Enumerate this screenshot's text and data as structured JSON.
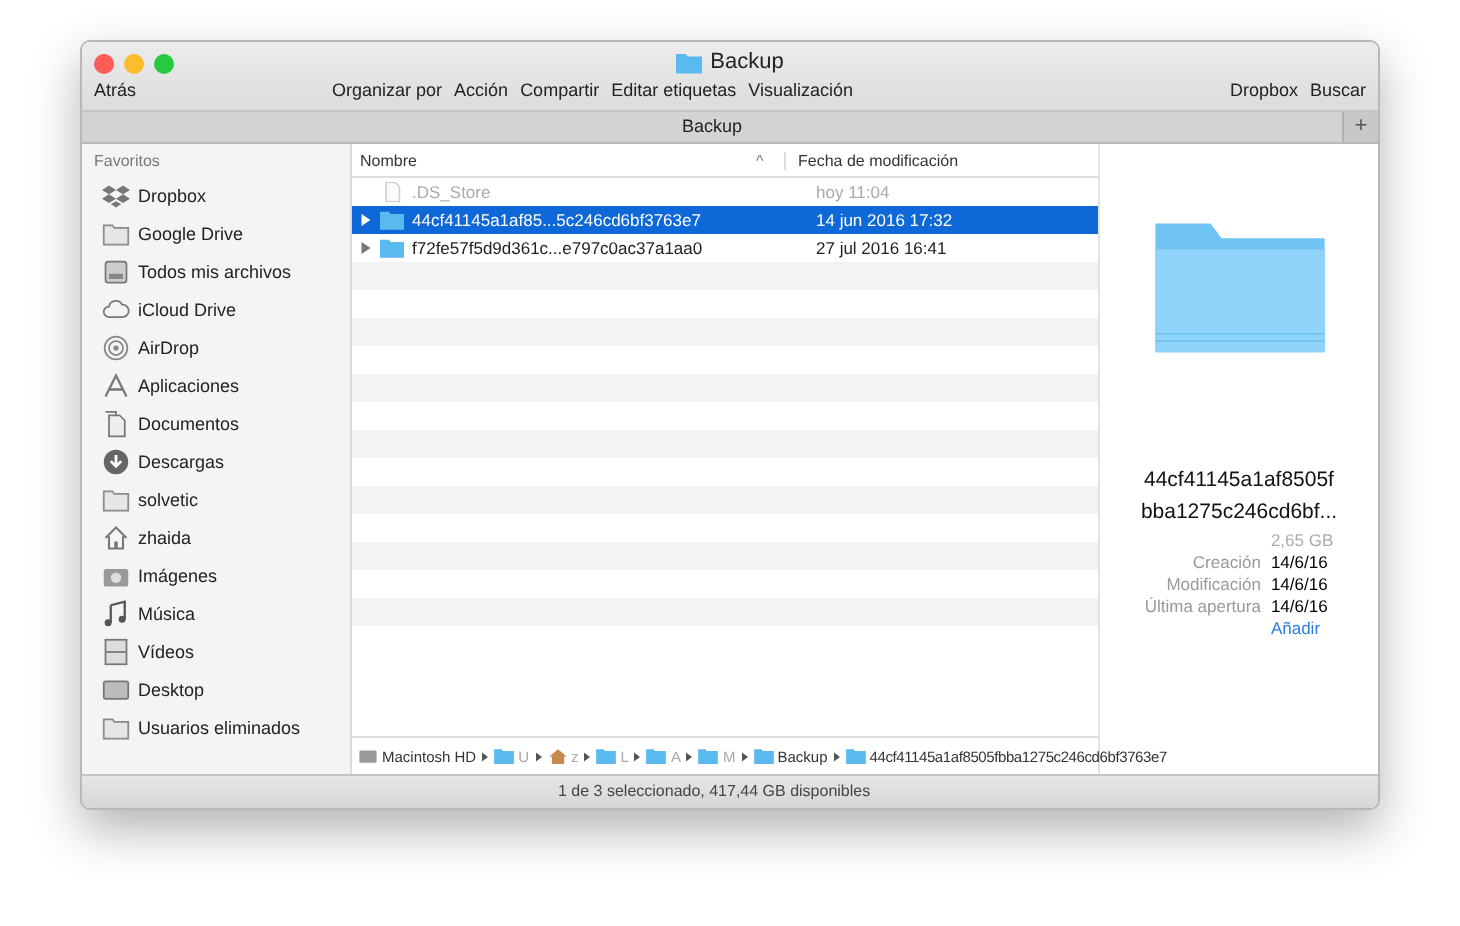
{
  "window": {
    "title": "Backup"
  },
  "toolbar": {
    "back": "Atrás",
    "actions": [
      "Organizar por",
      "Acción",
      "Compartir",
      "Editar etiquetas",
      "Visualización"
    ],
    "right": [
      "Dropbox",
      "Buscar"
    ]
  },
  "tab_bar": {
    "label": "Backup",
    "add": "+"
  },
  "sidebar": {
    "heading": "Favoritos",
    "items": [
      {
        "label": "Dropbox",
        "kind": "dropbox"
      },
      {
        "label": "Google Drive",
        "kind": "folder"
      },
      {
        "label": "Todos mis archivos",
        "kind": "drawer"
      },
      {
        "label": "iCloud Drive",
        "kind": "cloud"
      },
      {
        "label": "AirDrop",
        "kind": "airdrop"
      },
      {
        "label": "Aplicaciones",
        "kind": "apps"
      },
      {
        "label": "Documentos",
        "kind": "docs"
      },
      {
        "label": "Descargas",
        "kind": "download"
      },
      {
        "label": "solvetic",
        "kind": "folder"
      },
      {
        "label": "zhaida",
        "kind": "home"
      },
      {
        "label": "Imágenes",
        "kind": "camera"
      },
      {
        "label": "Música",
        "kind": "music"
      },
      {
        "label": "Vídeos",
        "kind": "film"
      },
      {
        "label": "Desktop",
        "kind": "display"
      },
      {
        "label": "Usuarios eliminados",
        "kind": "folder"
      }
    ]
  },
  "table": {
    "columns": [
      "Nombre",
      "Fecha de modificación"
    ],
    "sort_indicator": "^",
    "rows": [
      {
        "name": ".DS_Store",
        "date": "hoy 11:04",
        "kind": "file",
        "selected": false
      },
      {
        "name": "44cf41145a1af85...5c246cd6bf3763e7",
        "date": "14 jun 2016 17:32",
        "kind": "folder",
        "selected": true
      },
      {
        "name": "f72fe57f5d9d361c...e797c0ac37a1aa0",
        "date": "27 jul 2016 16:41",
        "kind": "folder",
        "selected": false
      }
    ]
  },
  "preview": {
    "name_lines": [
      "44cf41145a1af8505f",
      "bba1275c246cd6bf..."
    ],
    "size": "2,65 GB",
    "details": [
      {
        "label": "Creación",
        "value": "14/6/16"
      },
      {
        "label": "Modificación",
        "value": "14/6/16"
      },
      {
        "label": "Última apertura",
        "value": "14/6/16"
      }
    ],
    "tags_link": "Añadir"
  },
  "path_bar": [
    {
      "label": "Macintosh HD",
      "kind": "disk"
    },
    {
      "label": "U",
      "kind": "folder"
    },
    {
      "label": "z",
      "kind": "home"
    },
    {
      "label": "L",
      "kind": "folder"
    },
    {
      "label": "A",
      "kind": "folder"
    },
    {
      "label": "M",
      "kind": "folder"
    },
    {
      "label": "Backup",
      "kind": "folder"
    },
    {
      "label": "44cf41145a1af8505fbba1275c246cd6bf3763e7",
      "kind": "folder"
    }
  ],
  "status_bar": "1 de 3 seleccionado, 417,44 GB disponibles"
}
